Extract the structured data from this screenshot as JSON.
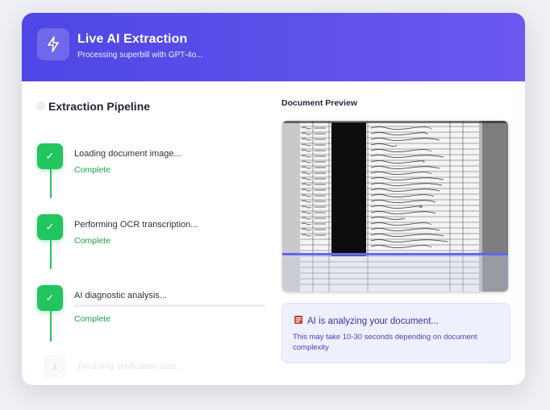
{
  "header": {
    "title": "Live AI Extraction",
    "subtitle": "Processing superbill with GPT-4o...",
    "icon": "lightning-icon"
  },
  "pipeline": {
    "title": "Extraction Pipeline",
    "steps": [
      {
        "label": "Loading document image...",
        "status": "Complete"
      },
      {
        "label": "Performing OCR transcription...",
        "status": "Complete"
      },
      {
        "label": "AI diagnostic analysis...",
        "status": "Complete",
        "progress_fraction": 0
      },
      {
        "label": "Finalizing verification data...",
        "status": ""
      }
    ]
  },
  "preview": {
    "title": "Document Preview"
  },
  "analysis": {
    "icon": "book-icon",
    "title": "AI is analyzing your document...",
    "description": "This may take 10-30 seconds depending on document complexity"
  },
  "colors": {
    "accent": "#4f46e5",
    "success": "#22c55e",
    "scan_line": "#6366f1"
  }
}
